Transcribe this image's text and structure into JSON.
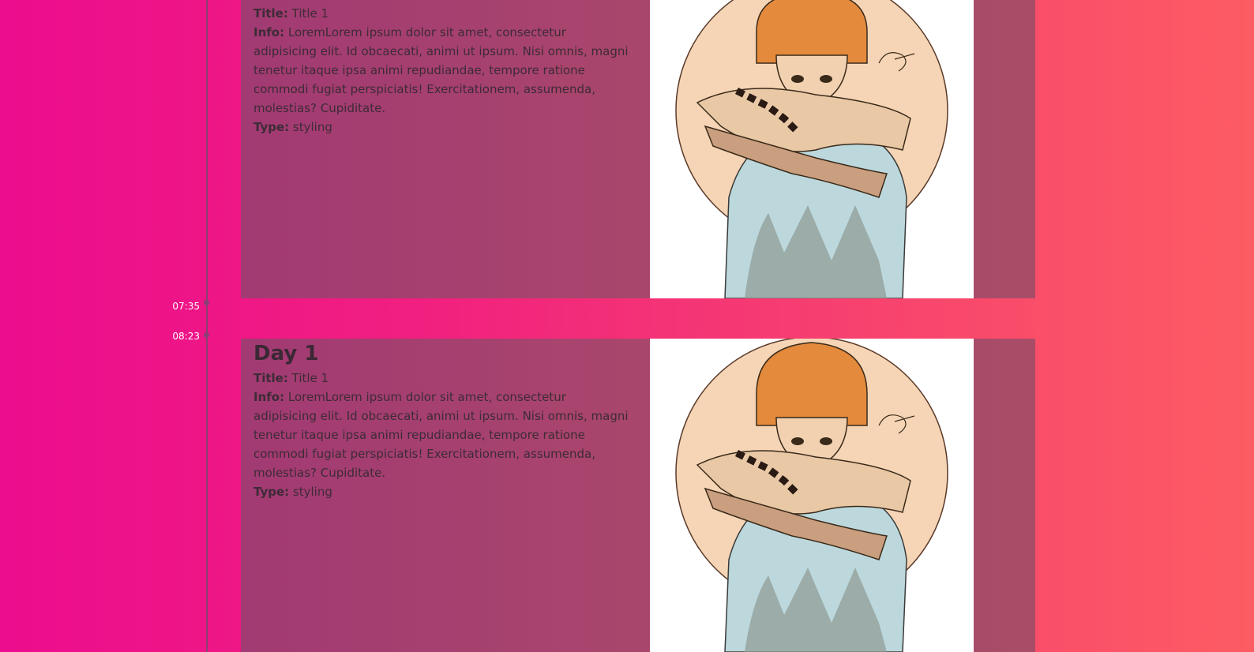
{
  "timeline": {
    "entries": [
      {
        "time": "07:35"
      },
      {
        "time": "08:23"
      }
    ]
  },
  "cards": [
    {
      "title": "",
      "fields": {
        "title_label": "Title:",
        "title_value": " Title 1",
        "info_label": "Info:",
        "info_value": " LoremLorem ipsum dolor sit amet, consectetur adipisicing elit. Id obcaecati, animi ut ipsum. Nisi omnis, magni tenetur itaque ipsa animi repudiandae, tempore ratione commodi fugiat perspiciatis! Exercitationem, assumenda, molestias? Cupiditate.",
        "type_label": "Type:",
        "type_value": " styling"
      },
      "image_signature": "SIRDEN"
    },
    {
      "title": "Day 1",
      "fields": {
        "title_label": "Title:",
        "title_value": " Title 1",
        "info_label": "Info:",
        "info_value": " LoremLorem ipsum dolor sit amet, consectetur adipisicing elit. Id obcaecati, animi ut ipsum. Nisi omnis, magni tenetur itaque ipsa animi repudiandae, tempore ratione commodi fugiat perspiciatis! Exercitationem, assumenda, molestias? Cupiditate.",
        "type_label": "Type:",
        "type_value": " styling"
      },
      "image_signature": "SIRDEN"
    }
  ],
  "colors": {
    "background_start": "#ec0c8e",
    "background_end": "#fd5c63",
    "card_background": "#a9466c",
    "timeline_line": "#8a3e74",
    "time_label": "#ffffff"
  }
}
